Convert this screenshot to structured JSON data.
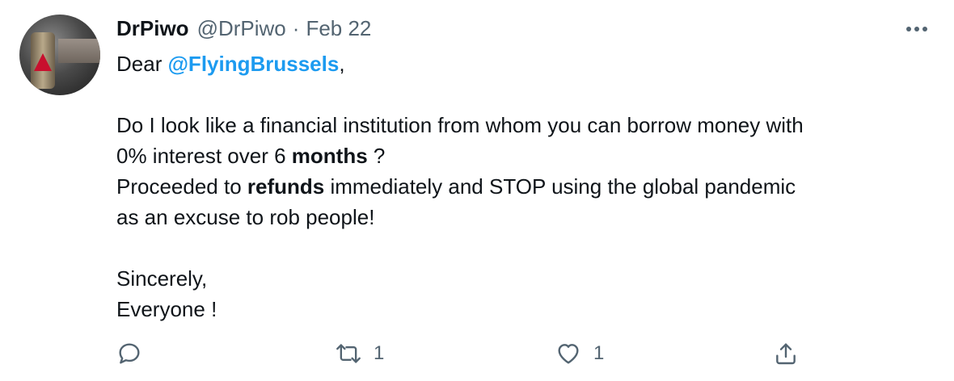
{
  "tweet": {
    "author_name": "DrPiwo",
    "author_handle": "@DrPiwo",
    "separator": "·",
    "date": "Feb 22",
    "greeting": "Dear ",
    "mention": "@FlyingBrussels",
    "greeting_end": ",",
    "line1": "Do I look like a financial institution from whom you can borrow money with",
    "line2_a": "0% interest over 6 ",
    "line2_bold": "months",
    "line2_b": " ?",
    "line3_a": "Proceeded to ",
    "line3_bold": "refunds",
    "line3_b": " immediately and STOP using the global pandemic",
    "line4": "as an excuse to rob people!",
    "sign1": "Sincerely,",
    "sign2": "Everyone !"
  },
  "actions": {
    "reply_icon": "reply-icon",
    "retweet_icon": "retweet-icon",
    "retweet_count": "1",
    "like_icon": "heart-icon",
    "like_count": "1",
    "share_icon": "share-icon"
  },
  "colors": {
    "mention": "#1d9bf0",
    "secondary_text": "#536471",
    "primary_text": "#0f1419"
  }
}
